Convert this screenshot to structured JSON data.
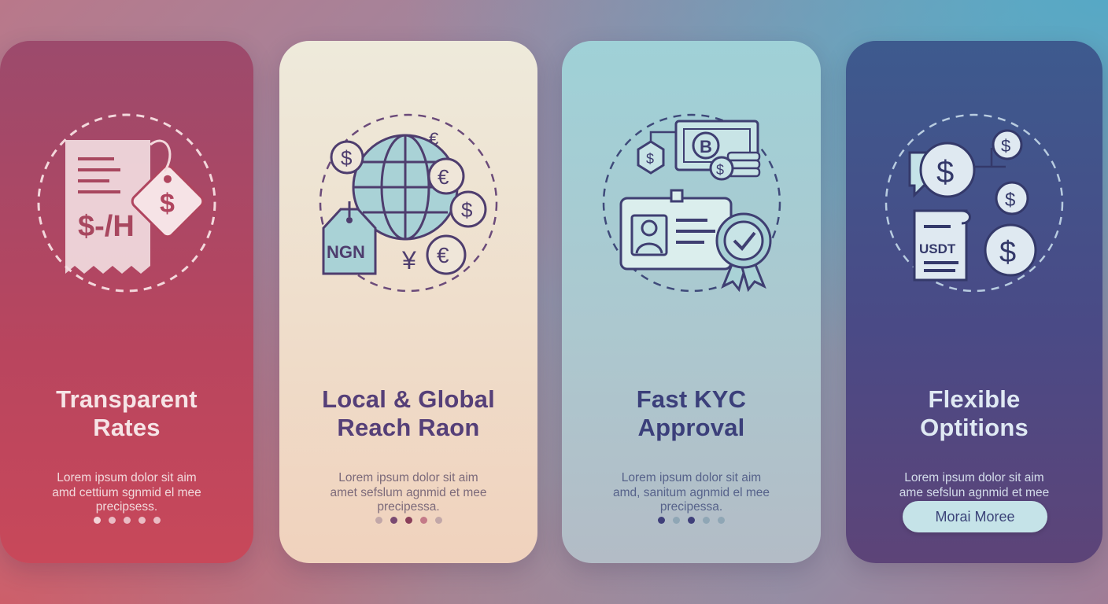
{
  "cards": [
    {
      "title": "Transparent\nRates",
      "body": "Lorem ipsum dolor sit aim\namd cettium sgnmid el mee\nprecipsess.",
      "illustration_icons": [
        "receipt-icon",
        "price-tag-dollar-icon"
      ],
      "illustration_text": "$-/H",
      "dots": 5
    },
    {
      "title": "Local & Global\nReach Raon",
      "body": "Lorem ipsum dolor sit aim\namet sefslum agnmid et mee\nprecipessa.",
      "illustration_icons": [
        "globe-icon",
        "dollar-coin-icon",
        "euro-coin-icon",
        "yen-icon",
        "price-tag-icon"
      ],
      "tag_label": "NGN",
      "dots": 5
    },
    {
      "title": "Fast KYC\nApproval",
      "body": "Lorem ipsum dolor sit aim\namd, sanitum agnmid el mee\nprecipessa.",
      "illustration_icons": [
        "banknote-icon",
        "coin-stack-icon",
        "id-card-icon",
        "approval-badge-icon"
      ],
      "dots": 5
    },
    {
      "title": "Flexible\nOptitions",
      "body": "Lorem ipsum dolor sit aim\name sefslun agnmid et mee\nprecipesss.",
      "illustration_icons": [
        "dollar-coin-icon",
        "chat-bubble-icon",
        "document-icon"
      ],
      "doc_label": "USDT",
      "button_label": "Morai Moree"
    }
  ],
  "colors": {
    "card1": "#b9455e",
    "card2": "#efdcc9",
    "card3": "#acc8cf",
    "card4": "#4a4a86",
    "button": "#c5e3e8"
  }
}
